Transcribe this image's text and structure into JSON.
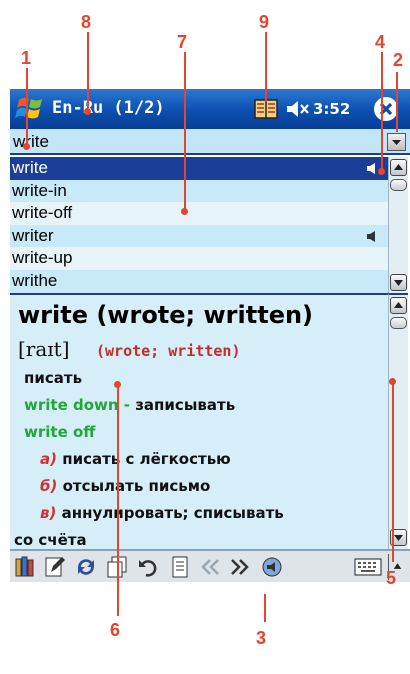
{
  "window": {
    "title": "En-Ru  (1/2)",
    "clock": "3:52"
  },
  "search": {
    "value": "write"
  },
  "word_list": [
    {
      "word": "write",
      "sound": true,
      "selected": true
    },
    {
      "word": "write-in",
      "sound": false
    },
    {
      "word": "write-off",
      "sound": false
    },
    {
      "word": "writer",
      "sound": true
    },
    {
      "word": "write-up",
      "sound": false
    },
    {
      "word": "writhe",
      "sound": false
    }
  ],
  "article": {
    "headword": "write (wrote; written)",
    "transcription": "[raɪt]",
    "forms": "(wrote; written)",
    "lines": [
      {
        "kind": "plain",
        "text": "писать"
      },
      {
        "kind": "phrase",
        "phrase": "write down",
        "sep": " - ",
        "text": "записывать"
      },
      {
        "kind": "phrase_only",
        "phrase": "write off"
      },
      {
        "kind": "sense",
        "num": "а)",
        "text": "писать с лёгкостью"
      },
      {
        "kind": "sense",
        "num": "б)",
        "text": "отсылать письмо"
      },
      {
        "kind": "sense",
        "num": "в)",
        "text": "аннулировать; списывать"
      },
      {
        "kind": "plain",
        "text": "со счёта"
      }
    ]
  },
  "toolbar": {
    "items": [
      "dictionaries-icon",
      "edit-icon",
      "refresh-icon",
      "copy-icon",
      "undo-icon",
      "page-icon",
      "back-icon",
      "forward-icon",
      "speak-icon"
    ],
    "keyboard": "keyboard-icon"
  },
  "callouts": [
    "1",
    "2",
    "3",
    "4",
    "5",
    "6",
    "7",
    "8",
    "9"
  ],
  "colors": {
    "callout": "#e2462f",
    "titlebar": "#0b4fb0",
    "selection": "#1b3f98",
    "phrase": "#23a639",
    "forms": "#c62b2b"
  }
}
